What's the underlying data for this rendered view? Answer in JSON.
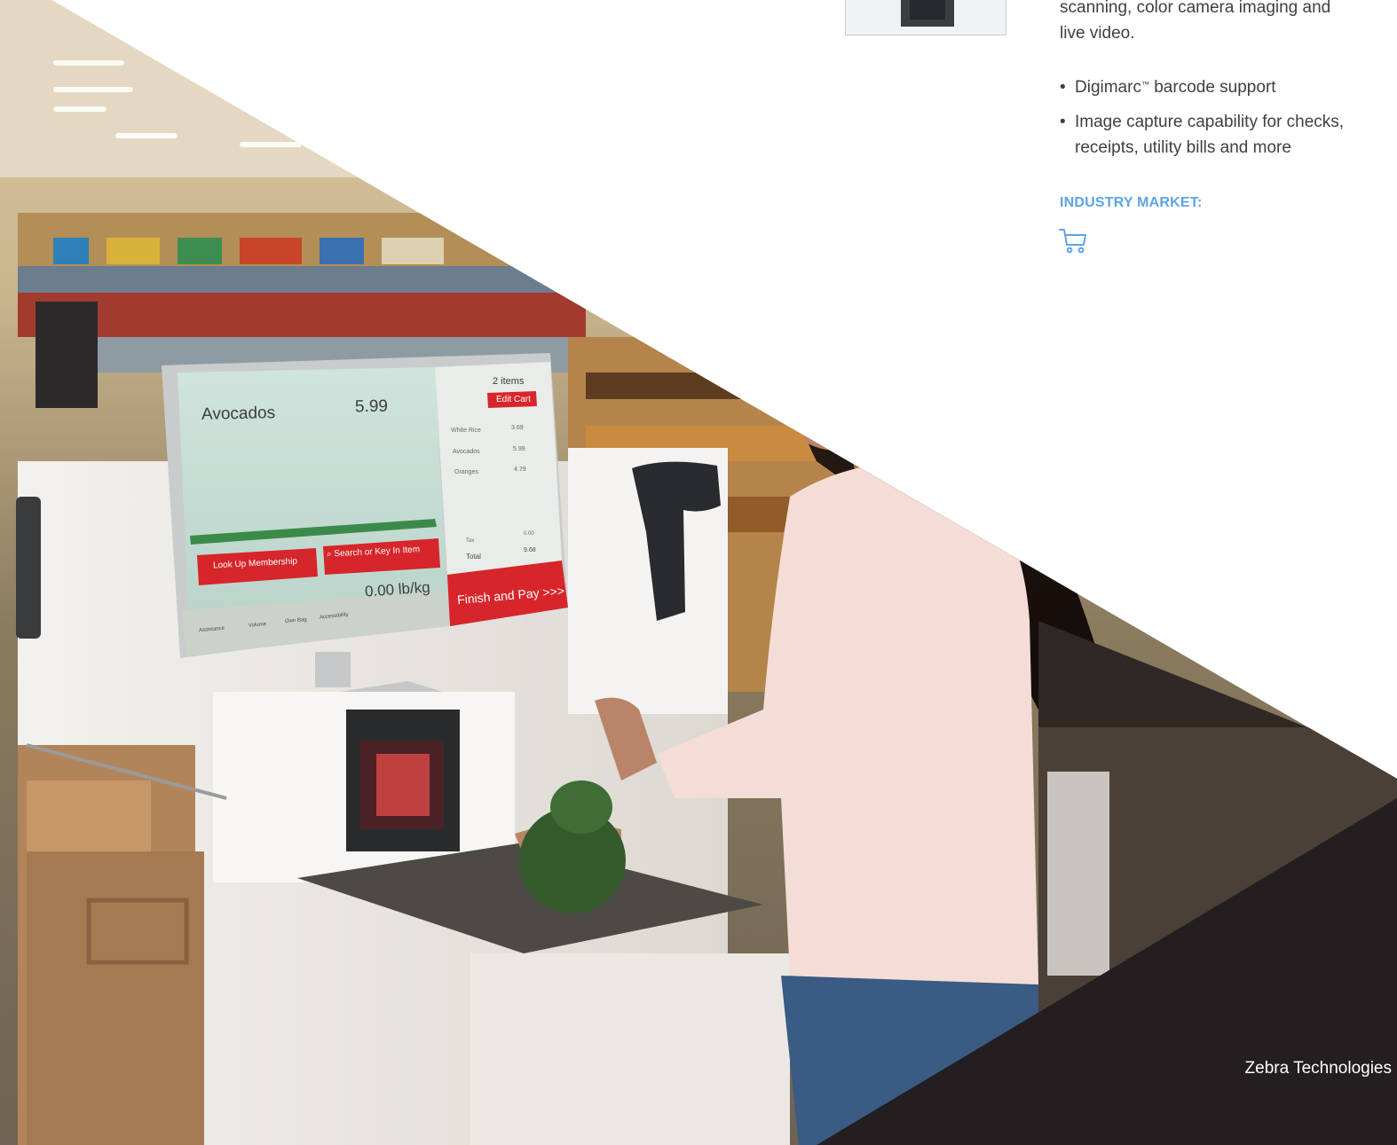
{
  "intro_text": "scanning, color camera imaging and live video.",
  "intro_line1": "scanning, color camera imaging and",
  "intro_line2": "live video.",
  "bullets": [
    {
      "line1": "Digimarc",
      "tm": "™",
      "rest": " barcode support"
    },
    {
      "line1": "Image capture capability for checks,",
      "line2": "receipts, utility bills and more"
    }
  ],
  "industry_market_label": "INDUSTRY MARKET:",
  "industry_icon": "shopping-cart-icon",
  "company": "Zebra Technologies",
  "kiosk_screen": {
    "item_name": "Avocados",
    "item_price": "5.99",
    "cart_count": "2 items",
    "edit_cart": "Edit Cart",
    "cart_items": [
      {
        "name": "White Rice",
        "price": "3.69"
      },
      {
        "name": "Avocados",
        "price": "5.99"
      },
      {
        "name": "Oranges",
        "price": "4.79"
      }
    ],
    "tax_label": "Tax",
    "tax_value": "0.00",
    "total_label": "Total",
    "total_value": "9.68",
    "look_up_membership": "Look Up Membership",
    "search_or_key_in": "Search or Key In Item",
    "weight": "0.00 lb/kg",
    "finish_and_pay": "Finish and Pay >>>",
    "footer_buttons": [
      "Assistance",
      "Volume",
      "Own Bag",
      "Accessibility"
    ]
  },
  "colors": {
    "accent_blue": "#5ca4e6",
    "brand_red": "#d6262b",
    "dark_corner": "#231f20"
  }
}
